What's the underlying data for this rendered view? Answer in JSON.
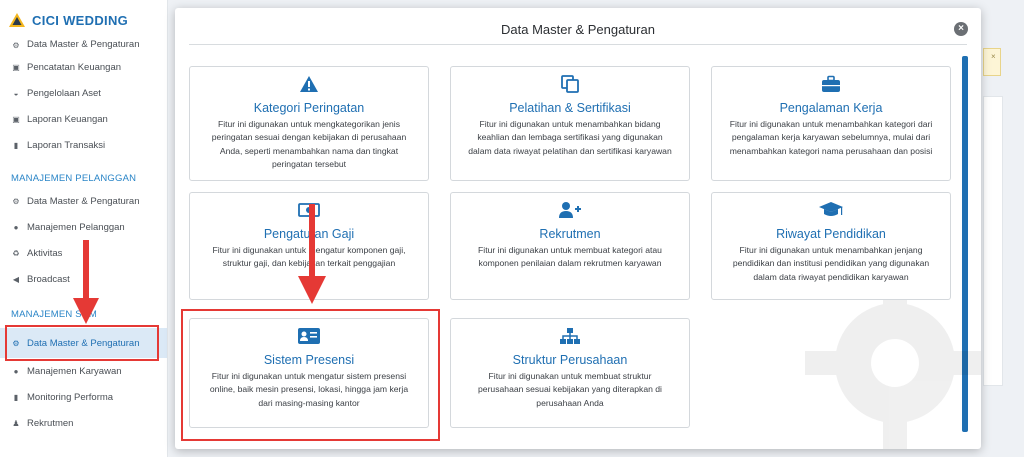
{
  "brand": {
    "name": "CICI WEDDING"
  },
  "sidebar": {
    "items": [
      {
        "label": "Data Master & Pengaturan",
        "icon": "cogs-icon",
        "cut": true
      },
      {
        "label": "Pencatatan Keuangan",
        "icon": "money-icon"
      },
      {
        "label": "Pengelolaan Aset",
        "icon": "car-icon"
      },
      {
        "label": "Laporan Keuangan",
        "icon": "money-icon"
      },
      {
        "label": "Laporan Transaksi",
        "icon": "book-icon"
      }
    ],
    "section_pelanggan": "MANAJEMEN PELANGGAN",
    "pelanggan_items": [
      {
        "label": "Data Master & Pengaturan",
        "icon": "cogs-icon"
      },
      {
        "label": "Manajemen Pelanggan",
        "icon": "users-icon"
      },
      {
        "label": "Aktivitas",
        "icon": "recycle-icon"
      },
      {
        "label": "Broadcast",
        "icon": "bullhorn-icon"
      }
    ],
    "section_sdm": "MANAJEMEN SDM",
    "sdm_items": [
      {
        "label": "Data Master & Pengaturan",
        "icon": "cogs-icon",
        "active": true
      },
      {
        "label": "Manajemen Karyawan",
        "icon": "users-icon"
      },
      {
        "label": "Monitoring Performa",
        "icon": "book-icon"
      },
      {
        "label": "Rekrutmen",
        "icon": "user-plus-icon"
      }
    ]
  },
  "modal": {
    "title": "Data Master & Pengaturan",
    "close_label": "×",
    "cards": [
      {
        "title": "Kategori Peringatan",
        "icon": "warning-icon",
        "desc": "Fitur ini digunakan untuk mengkategorikan jenis peringatan sesuai dengan kebijakan di perusahaan Anda, seperti menambahkan nama dan tingkat peringatan tersebut"
      },
      {
        "title": "Pelatihan & Sertifikasi",
        "icon": "copy-icon",
        "desc": "Fitur ini digunakan untuk menambahkan bidang keahlian dan lembaga sertifikasi yang digunakan dalam data riwayat pelatihan dan sertifikasi karyawan"
      },
      {
        "title": "Pengalaman Kerja",
        "icon": "briefcase-icon",
        "desc": "Fitur ini digunakan untuk menambahkan kategori dari pengalaman kerja karyawan sebelumnya, mulai dari menambahkan kategori nama perusahaan dan posisi"
      },
      {
        "title": "Pengaturan Gaji",
        "icon": "money-icon",
        "desc": "Fitur ini digunakan untuk mengatur komponen gaji, struktur gaji, dan kebijakan terkait penggajian"
      },
      {
        "title": "Rekrutmen",
        "icon": "user-plus-icon",
        "desc": "Fitur ini digunakan untuk membuat kategori atau komponen penilaian dalam rekrutmen karyawan"
      },
      {
        "title": "Riwayat Pendidikan",
        "icon": "graduation-cap-icon",
        "desc": "Fitur ini digunakan untuk menambahkan jenjang pendidikan dan institusi pendidikan yang digunakan dalam data riwayat pendidikan karyawan"
      },
      {
        "title": "Sistem Presensi",
        "icon": "id-card-icon",
        "desc": "Fitur ini digunakan untuk mengatur sistem presensi online, baik mesin presensi, lokasi, hingga jam kerja dari masing-masing kantor"
      },
      {
        "title": "Struktur Perusahaan",
        "icon": "sitemap-icon",
        "desc": "Fitur ini digunakan untuk membuat struktur perusahaan sesuai kebijakan yang diterapkan di perusahaan Anda"
      }
    ]
  },
  "colors": {
    "accent": "#1f6fb2",
    "annotation": "#e53935"
  }
}
